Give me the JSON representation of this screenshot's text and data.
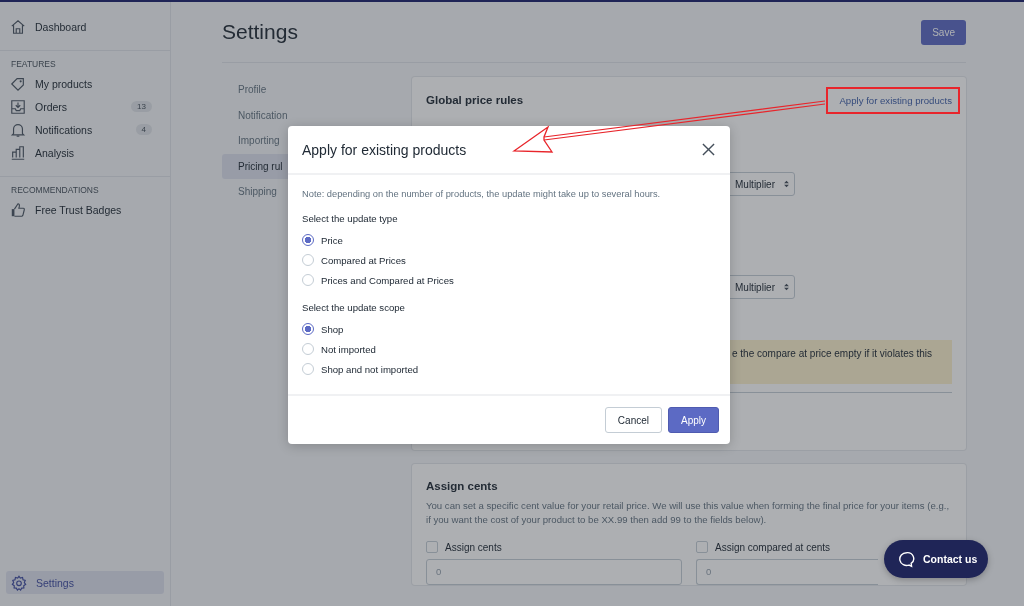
{
  "sidebar": {
    "top_item": {
      "label": "Dashboard",
      "selected": false
    },
    "sections": [
      {
        "heading": "FEATURES",
        "items": [
          {
            "label": "My products",
            "selected": false
          },
          {
            "label": "Orders",
            "badge": "13",
            "selected": false
          },
          {
            "label": "Notifications",
            "badge": "4",
            "selected": false
          },
          {
            "label": "Analysis",
            "selected": false
          }
        ]
      },
      {
        "heading": "RECOMMENDATIONS",
        "items": [
          {
            "label": "Free Trust Badges",
            "selected": false
          }
        ]
      }
    ],
    "bottom_item": {
      "label": "Settings",
      "selected": true
    }
  },
  "page": {
    "title": "Settings",
    "save_button": "Save"
  },
  "settings_nav": [
    {
      "label": "Profile",
      "selected": false
    },
    {
      "label": "Notification",
      "selected": false
    },
    {
      "label": "Importing",
      "selected": false
    },
    {
      "label": "Pricing rul",
      "selected": true
    },
    {
      "label": "Shipping",
      "selected": false
    }
  ],
  "global_price_rules": {
    "title": "Global price rules",
    "link": "Apply for existing products",
    "selects": [
      "Multiplier",
      "Multiplier"
    ],
    "warning_text": "e the compare at price empty if it violates this"
  },
  "assign_cents": {
    "title": "Assign cents",
    "description": "You can set a specific cent value for your retail price. We will use this value when forming the final price for your items (e.g., if you want the cost of your product to be XX.99 then add 99 to the fields below).",
    "fields": [
      {
        "label": "Assign cents",
        "checked": false,
        "value": "0"
      },
      {
        "label": "Assign compared at cents",
        "checked": false,
        "value": "0"
      }
    ]
  },
  "modal": {
    "title": "Apply for existing products",
    "note": "Note: depending on the number of products, the update might take up to several hours.",
    "groups": [
      {
        "label": "Select the update type",
        "options": [
          {
            "label": "Price",
            "selected": true
          },
          {
            "label": "Compared at Prices",
            "selected": false
          },
          {
            "label": "Prices and Compared at Prices",
            "selected": false
          }
        ]
      },
      {
        "label": "Select the update scope",
        "options": [
          {
            "label": "Shop",
            "selected": true
          },
          {
            "label": "Not imported",
            "selected": false
          },
          {
            "label": "Shop and not imported",
            "selected": false
          }
        ]
      }
    ],
    "cancel_button": "Cancel",
    "apply_button": "Apply"
  },
  "contact_button": "Contact us"
}
